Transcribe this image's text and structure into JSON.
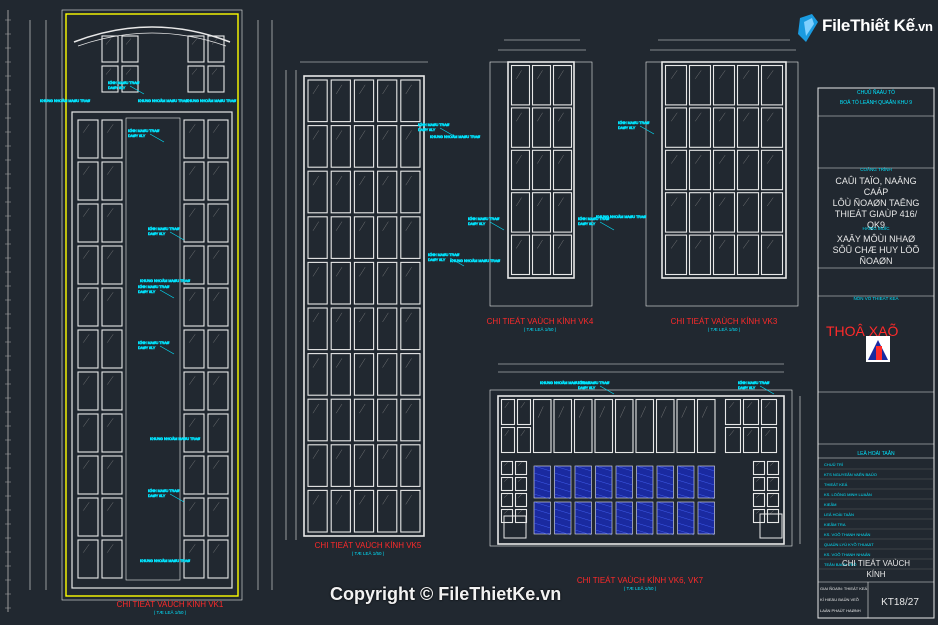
{
  "logo": {
    "brand": "FileThiết Kế",
    "suffix": ".vn"
  },
  "copyright": "Copyright © FileThietKe.vn",
  "drawings": {
    "vk1": {
      "title": "CHI TIEÁT VAÙCH KÍNH VK1",
      "scale": "( TÆ LEÄ 1/50 )"
    },
    "vk5": {
      "title": "CHI TIEÁT VAÙCH KÍNH VK5",
      "scale": "( TÆ LEÄ 1/50 )"
    },
    "vk4": {
      "title": "CHI TIEÁT VAÙCH KÍNH VK4",
      "scale": "( TÆ LEÄ 1/50 )"
    },
    "vk3": {
      "title": "CHI TIEÁT VAÙCH KÍNH VK3",
      "scale": "( TÆ LEÄ 1/50 )"
    },
    "vk6": {
      "title": "CHI TIEÁT VAÙCH KÍNH VK6, VK7",
      "scale": "( TÆ LEÄ 1/50 )"
    }
  },
  "notes": {
    "kinh_trang": "KÍNH MAØU TRAØ",
    "day": "DAØY 8LY",
    "khung": "KHUNG NHOÂM MAØU TRAØ",
    "kt": "KT: 150X50",
    "khung_trang": "KHUNG NHOÂM TRAÉNG",
    "cua": "CÖÛA KÍNH"
  },
  "title_block": {
    "owner_label": "CHUÛ ÑAÀU TÖ",
    "owner": "BOÄ TÖ LEÄNH QUAÂN KHU 9",
    "project_label": "COÂNG TRÌNH",
    "project": [
      "CAÛI TAÏO, NAÂNG",
      "CAÁP",
      "LÔÙ ÑOAØN TAÊNG",
      "THIEÁT GIAÙP 416/",
      "QK9"
    ],
    "item_label": "HAÏNG MUÏC",
    "item": [
      "XAÂY MÔÙI NHAØ",
      "SÔÛ CHÆ HUY LÖÕ",
      "ÑOAØN"
    ],
    "approval_label": "ÑÔN VÒ THIEÁT KEÁ",
    "company": "THOÂ XAÕ",
    "section_label": "LEÄ HOÀI TAÂN",
    "rows": [
      "CHUÛ TRÌ",
      "KTS NGUYEÃN VAÊN BAÛO",
      "THIEÁT KEÁ",
      "KS. LÖÔNG MINH LUAÂN",
      "KIEÅM",
      "LEÂ HOÀI TAÂN",
      "KIEÅM TRA",
      "KS. VOÕ THANH NHAÂN",
      "QUAÛN LYÙ KYÕ THUAÄT",
      "KS. VOÕ THANH NHAÂN",
      "TEÂN BAÛN VEÕ"
    ],
    "drawing_name": [
      "CHI TIEÁT VAÙCH",
      "KÍNH"
    ],
    "sheet_code": "KT18/27",
    "footer": [
      "GIAI ÑOAÏN: THIEÁT KEÁ",
      "KÍ HIEÄU BAÛN VEÕ",
      "LAÀN PHAÙT HAØNH"
    ]
  },
  "colors": {
    "bg": "#212830",
    "line": "#e8e8e8",
    "cyan": "#00e5ff",
    "red": "#ff2a2a",
    "yellow": "#ffff00",
    "blue": "#1a2aa0"
  }
}
